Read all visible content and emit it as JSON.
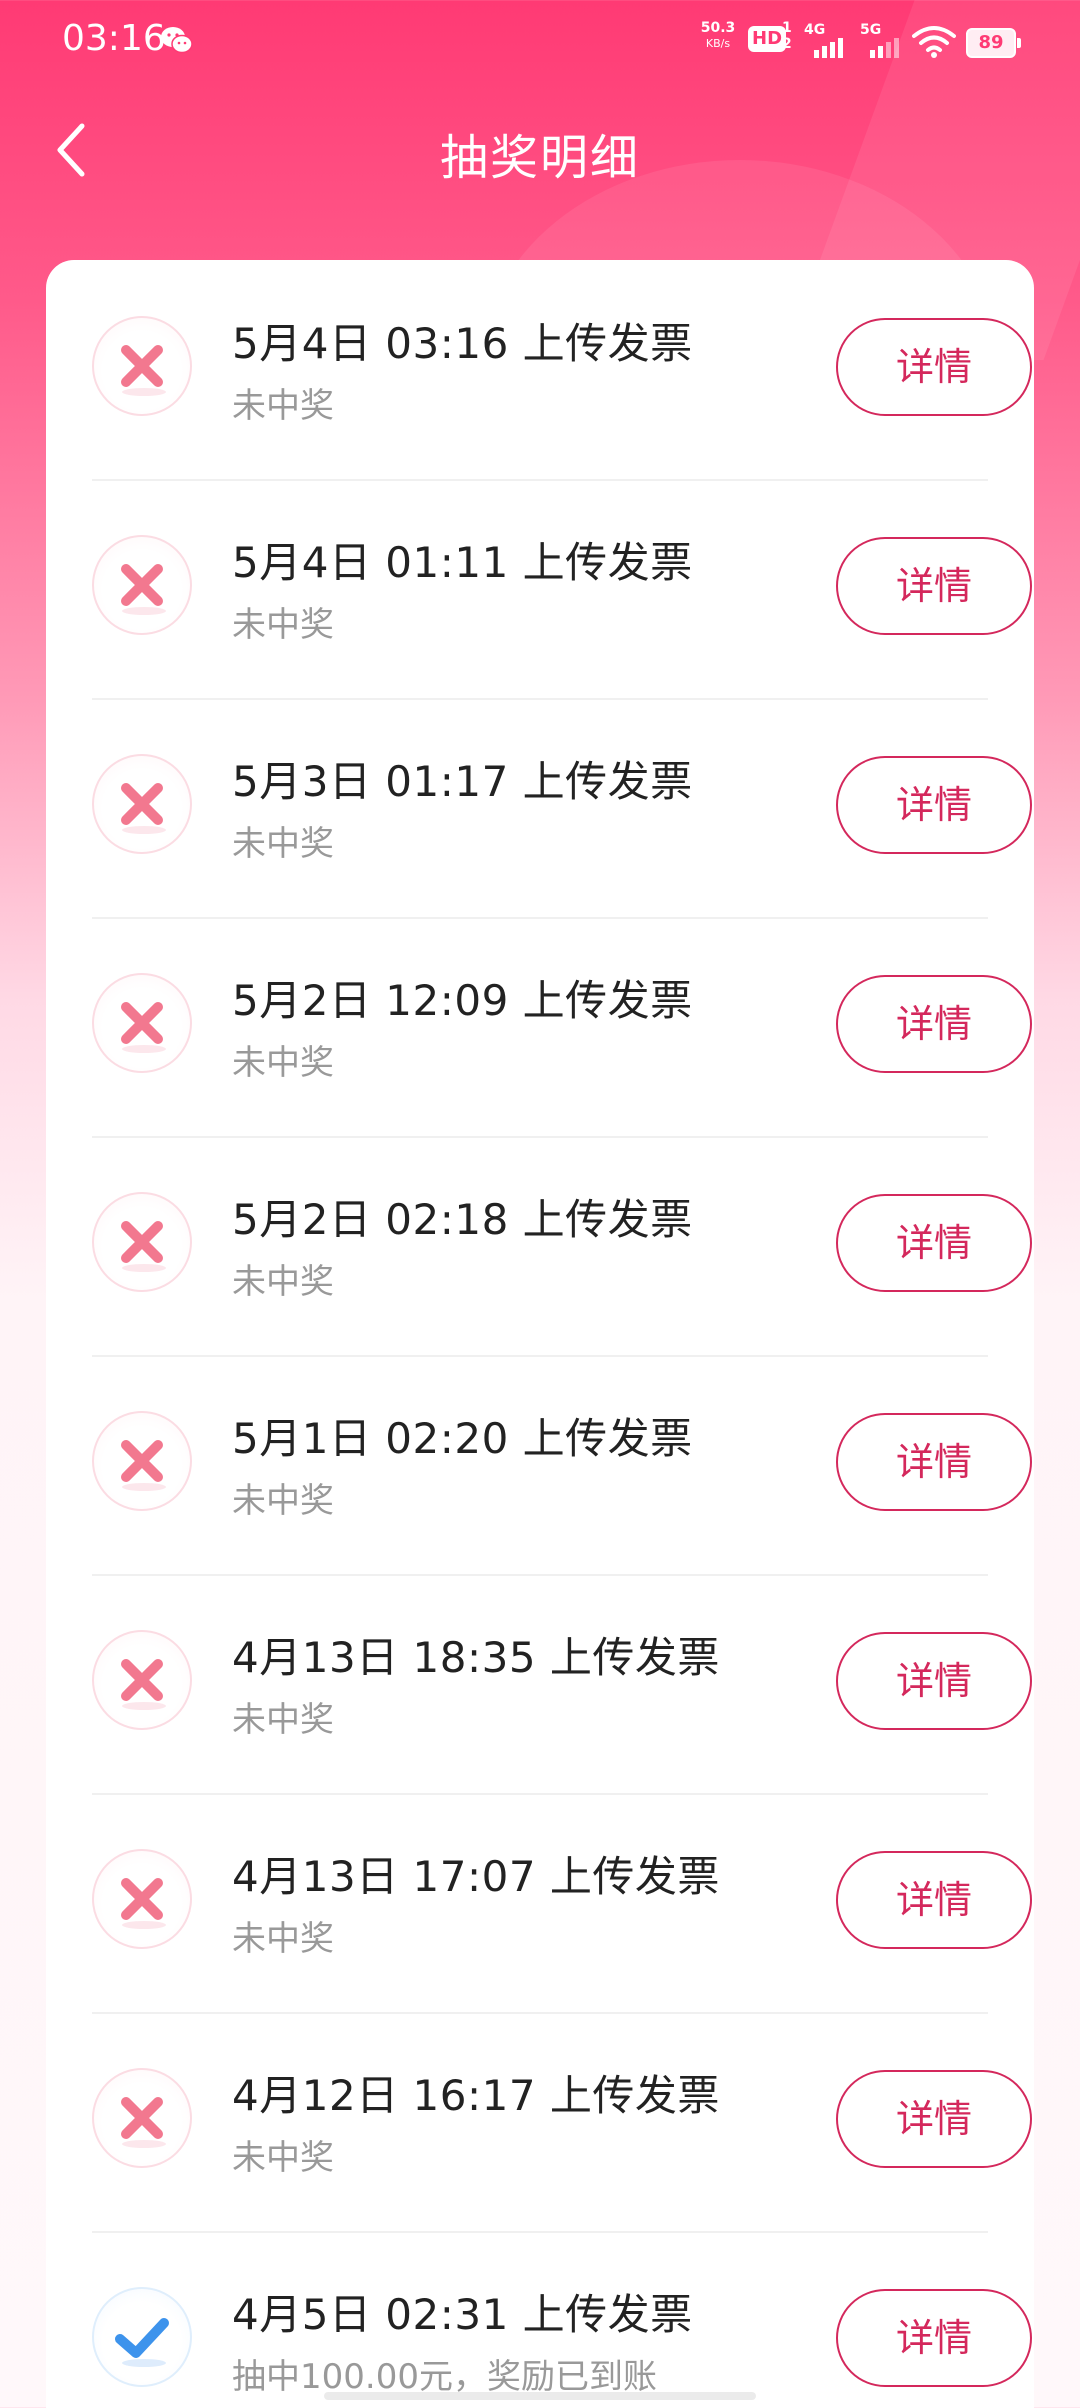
{
  "status_bar": {
    "time": "03:16",
    "net_speed": "50.3",
    "net_speed_unit": "KB/s",
    "hd_label": "HD",
    "hd_sub_top": "1",
    "hd_sub_bottom": "2",
    "signal1_label": "4G",
    "signal2_label": "5G",
    "battery": "89",
    "icons": [
      "wechat-icon",
      "wifi-icon",
      "battery-icon"
    ]
  },
  "header": {
    "title": "抽奖明细",
    "back_icon": "chevron-left-icon"
  },
  "theme": {
    "accent": "#d4285c",
    "header_gradient_top": "#ff3a74",
    "lose_icon_color": "#f2788f",
    "win_icon_color": "#3d93ec"
  },
  "records": [
    {
      "title": "5月4日  03:16  上传发票",
      "result": "未中奖",
      "status": "lose",
      "button": "详情"
    },
    {
      "title": "5月4日  01:11  上传发票",
      "result": "未中奖",
      "status": "lose",
      "button": "详情"
    },
    {
      "title": "5月3日  01:17  上传发票",
      "result": "未中奖",
      "status": "lose",
      "button": "详情"
    },
    {
      "title": "5月2日  12:09  上传发票",
      "result": "未中奖",
      "status": "lose",
      "button": "详情"
    },
    {
      "title": "5月2日  02:18  上传发票",
      "result": "未中奖",
      "status": "lose",
      "button": "详情"
    },
    {
      "title": "5月1日  02:20  上传发票",
      "result": "未中奖",
      "status": "lose",
      "button": "详情"
    },
    {
      "title": "4月13日  18:35  上传发票",
      "result": "未中奖",
      "status": "lose",
      "button": "详情"
    },
    {
      "title": "4月13日  17:07  上传发票",
      "result": "未中奖",
      "status": "lose",
      "button": "详情"
    },
    {
      "title": "4月12日  16:17  上传发票",
      "result": "未中奖",
      "status": "lose",
      "button": "详情"
    },
    {
      "title": "4月5日  02:31  上传发票",
      "result": "抽中100.00元，奖励已到账",
      "status": "win",
      "button": "详情"
    }
  ]
}
